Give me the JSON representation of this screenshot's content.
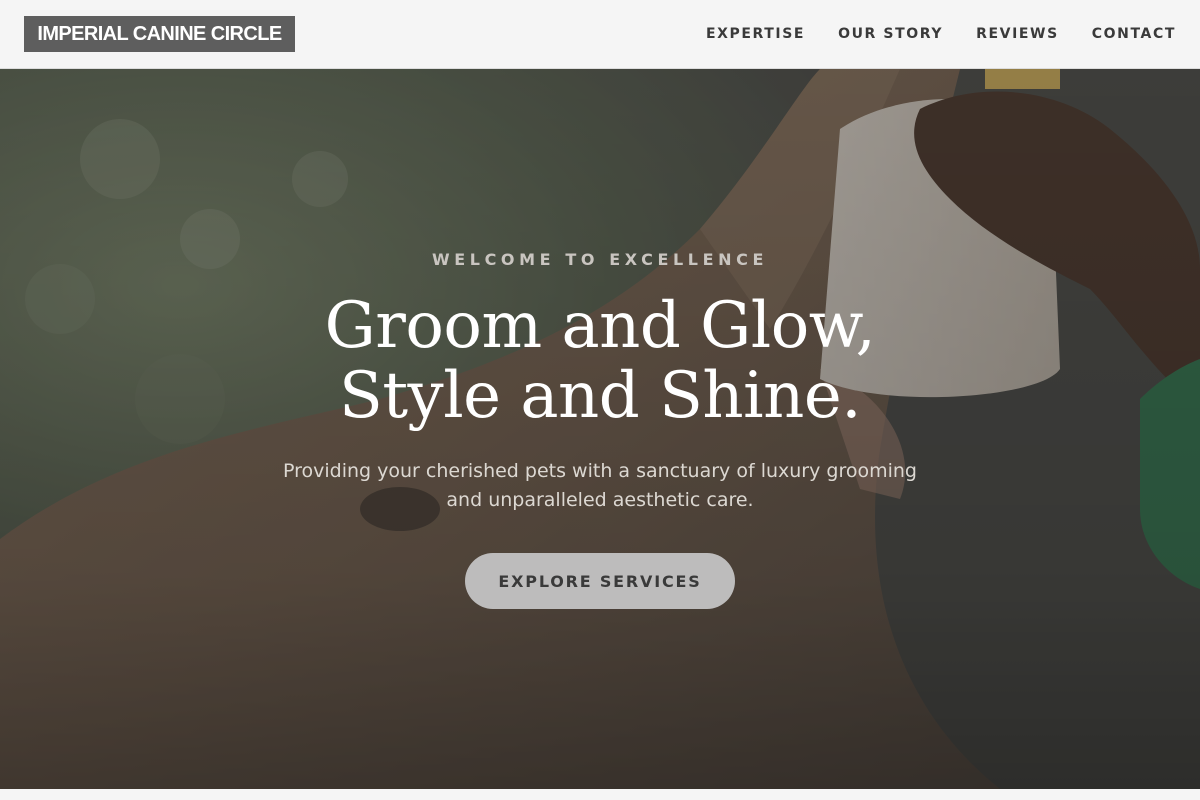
{
  "brand": {
    "logo_text": "IMPERIAL CANINE CIRCLE"
  },
  "nav": {
    "items": [
      {
        "label": "EXPERTISE"
      },
      {
        "label": "OUR STORY"
      },
      {
        "label": "REVIEWS"
      },
      {
        "label": "CONTACT"
      }
    ]
  },
  "hero": {
    "eyebrow": "WELCOME TO EXCELLENCE",
    "headline_line1": "Groom and Glow,",
    "headline_line2": "Style and Shine.",
    "subtext_line1": "Providing your cherished pets with a sanctuary of luxury grooming",
    "subtext_line2": "and unparalleled aesthetic care.",
    "cta_label": "EXPLORE SERVICES",
    "background_image": "elephant-being-bottle-fed-photo"
  },
  "colors": {
    "nav_background": "#f5f5f5",
    "logo_background": "#5e5e5e",
    "cta_background": "#bdbcbc",
    "text_dark": "#3a3a3a"
  }
}
